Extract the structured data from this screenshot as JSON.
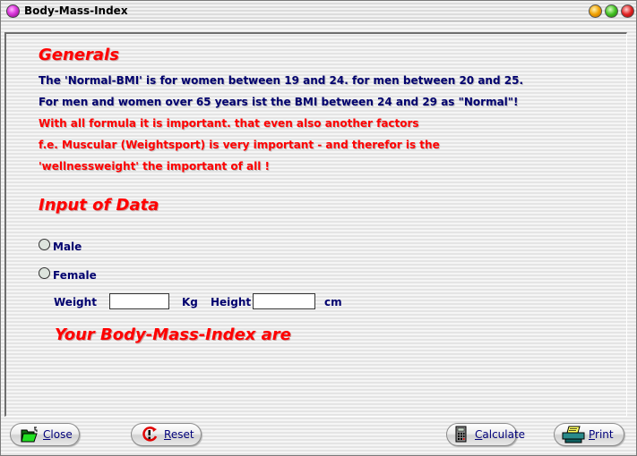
{
  "window": {
    "title": "Body-Mass-Index"
  },
  "generals": {
    "heading": "Generals",
    "lines": [
      {
        "text": "The 'Normal-BMI' is for women between 19 and 24. for men between 20 and 25.",
        "color": "#00006e"
      },
      {
        "text": "For men and women over 65 years ist the BMI between 24 and 29 as \"Normal\"!",
        "color": "#00006e"
      },
      {
        "text": "With all formula it is important. that even also another factors",
        "color": "#ff0000"
      },
      {
        "text": "f.e. Muscular (Weightsport) is very important - and therefor is the",
        "color": "#ff0000"
      },
      {
        "text": "'wellnessweight' the important of all !",
        "color": "#ff0000"
      }
    ]
  },
  "input": {
    "heading": "Input of Data",
    "gender_options": [
      {
        "label": "Male",
        "selected": false
      },
      {
        "label": "Female",
        "selected": false
      }
    ],
    "weight_label": "Weight",
    "weight_value": "",
    "weight_unit": "Kg",
    "height_label": "Height",
    "height_value": "",
    "height_unit": "cm",
    "result_label": "Your Body-Mass-Index are"
  },
  "buttons": {
    "close": {
      "first": "C",
      "rest": "lose"
    },
    "reset": {
      "first": "R",
      "rest": "eset"
    },
    "calculate": {
      "first": "C",
      "rest": "alculate"
    },
    "print": {
      "first": "P",
      "rest": "rint"
    }
  },
  "colors": {
    "heading": "#ff0000",
    "text_blue": "#00006e",
    "text_red": "#ff0000"
  }
}
